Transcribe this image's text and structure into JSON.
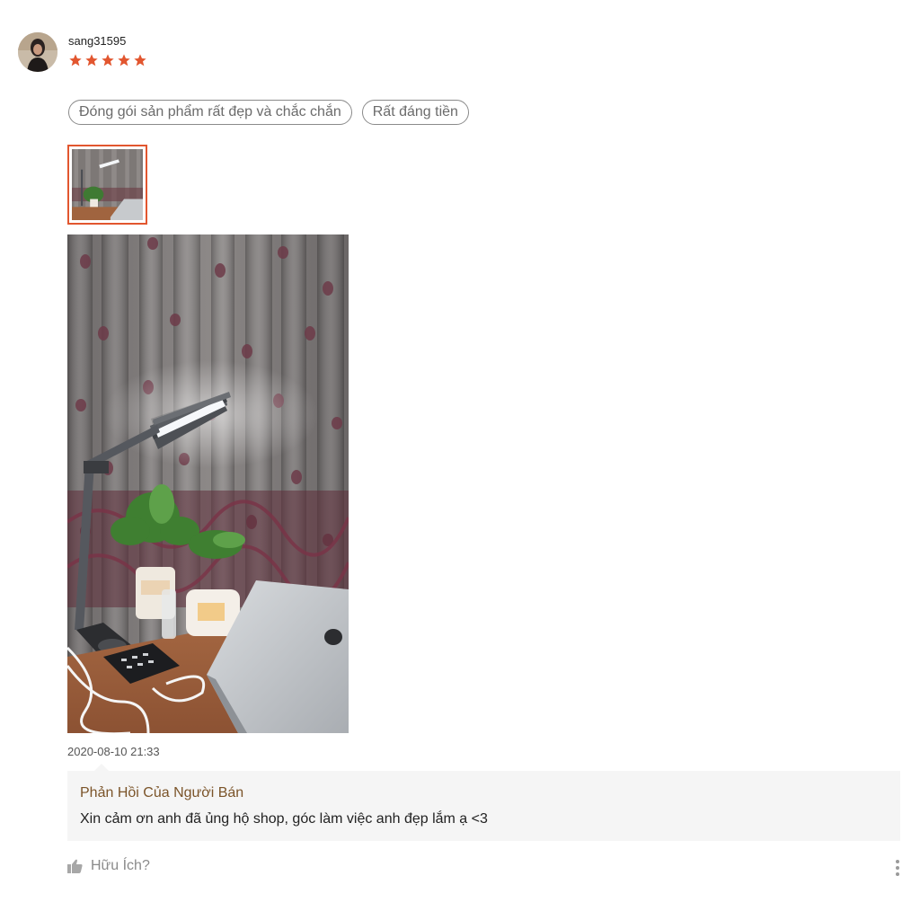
{
  "review": {
    "username": "sang31595",
    "rating": 5,
    "rating_max": 5,
    "star_color": "#e2562f",
    "tags": [
      "Đóng gói sản phẩm rất đẹp và chắc chắn",
      "Rất đáng tiền"
    ],
    "media_selected_index": 0,
    "timestamp": "2020-08-10 21:33"
  },
  "seller_reply": {
    "title": "Phản Hồi Của Người Bán",
    "text": "Xin cảm ơn anh đã ủng hộ shop, góc làm việc anh đẹp lắm ạ <3"
  },
  "actions": {
    "helpful_label": "Hữu Ích?",
    "helpful_icon": "thumbs-up-icon",
    "more_icon": "more-vertical-icon"
  },
  "colors": {
    "accent": "#e2562f",
    "reply_title": "#7b5429",
    "reply_background": "#f5f5f5"
  }
}
